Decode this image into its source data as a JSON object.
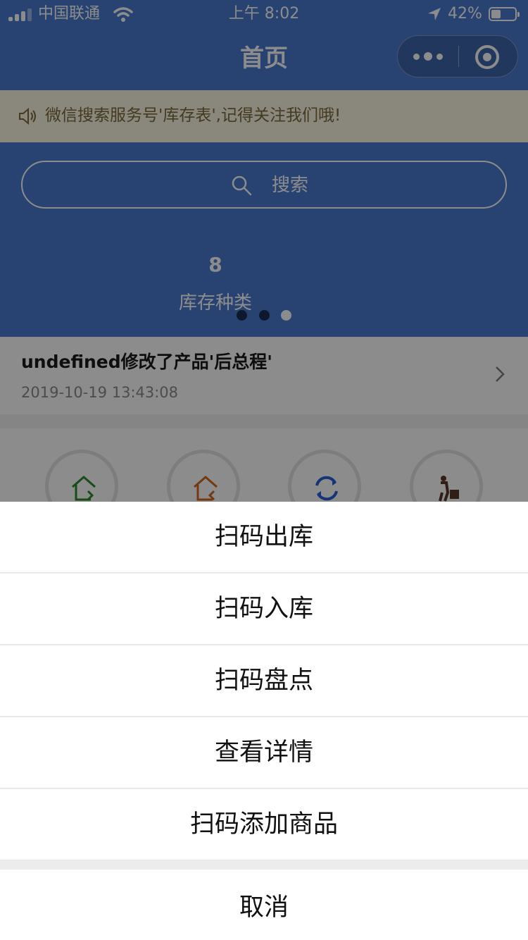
{
  "status_bar": {
    "carrier": "中国联通",
    "time": "上午 8:02",
    "battery_percent": "42%",
    "battery_level": 0.42,
    "signal_bars": 3,
    "icons": [
      "signal-icon",
      "wifi-icon",
      "location-arrow-icon",
      "battery-icon"
    ]
  },
  "nav": {
    "title": "首页",
    "capsule_icons": [
      "more-dots-icon",
      "close-mini-program-icon"
    ]
  },
  "notice": {
    "text": "微信搜索服务号'库存表',记得关注我们哦!",
    "icon": "speaker-icon"
  },
  "hero": {
    "search_placeholder": "搜索",
    "stat_value": "8",
    "stat_label": "库存种类",
    "carousel_count": 3,
    "carousel_active": 3
  },
  "activity": {
    "title": "undefined修改了产品'后总程'",
    "time": "2019-10-19 13:43:08"
  },
  "shortcuts": {
    "icons": [
      "stock-out-house-icon",
      "stock-in-house-icon",
      "inventory-sync-icon",
      "delivery-worker-icon"
    ],
    "colors": [
      "#2f8a2f",
      "#d2691e",
      "#2b5fd9",
      "#5a3a2a"
    ]
  },
  "action_sheet": {
    "items": [
      "扫码出库",
      "扫码入库",
      "扫码盘点",
      "查看详情",
      "扫码添加商品"
    ],
    "cancel": "取消"
  },
  "colors": {
    "primary": "#4a7bd0",
    "notice_bg": "#fbf6e4",
    "sheet_gap": "#ececec"
  }
}
